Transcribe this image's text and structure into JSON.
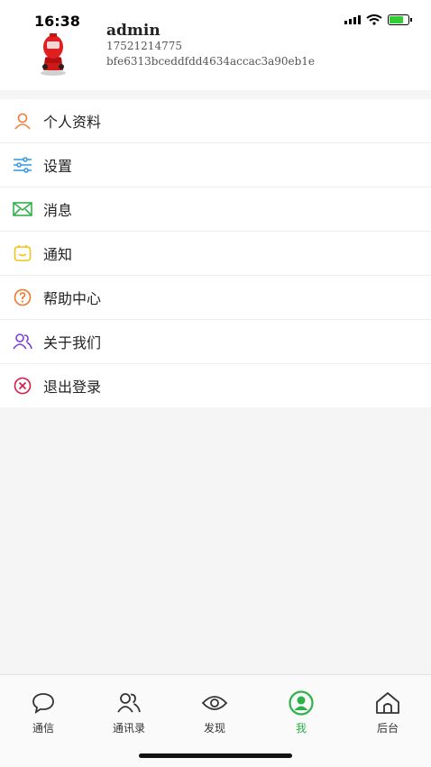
{
  "status_bar": {
    "time": "16:38"
  },
  "user": {
    "name": "admin",
    "phone": "17521214775",
    "id": "bfe6313bceddfdd4634accac3a90eb1e"
  },
  "menu": [
    {
      "label": "个人资料",
      "icon": "person-icon",
      "color": "#f07c3c"
    },
    {
      "label": "设置",
      "icon": "sliders-icon",
      "color": "#2f9be0"
    },
    {
      "label": "消息",
      "icon": "mail-icon",
      "color": "#33b04a"
    },
    {
      "label": "通知",
      "icon": "notice-icon",
      "color": "#f0c419"
    },
    {
      "label": "帮助中心",
      "icon": "help-icon",
      "color": "#f0762a"
    },
    {
      "label": "关于我们",
      "icon": "people-icon",
      "color": "#7a3cdc"
    },
    {
      "label": "退出登录",
      "icon": "logout-icon",
      "color": "#d81b45"
    }
  ],
  "tabs": [
    {
      "label": "通信",
      "icon": "chat-icon"
    },
    {
      "label": "通讯录",
      "icon": "contacts-icon"
    },
    {
      "label": "发现",
      "icon": "eye-icon"
    },
    {
      "label": "我",
      "icon": "profile-icon",
      "active": true
    },
    {
      "label": "后台",
      "icon": "home-icon"
    }
  ],
  "colors": {
    "accent": "#2bb34a"
  }
}
